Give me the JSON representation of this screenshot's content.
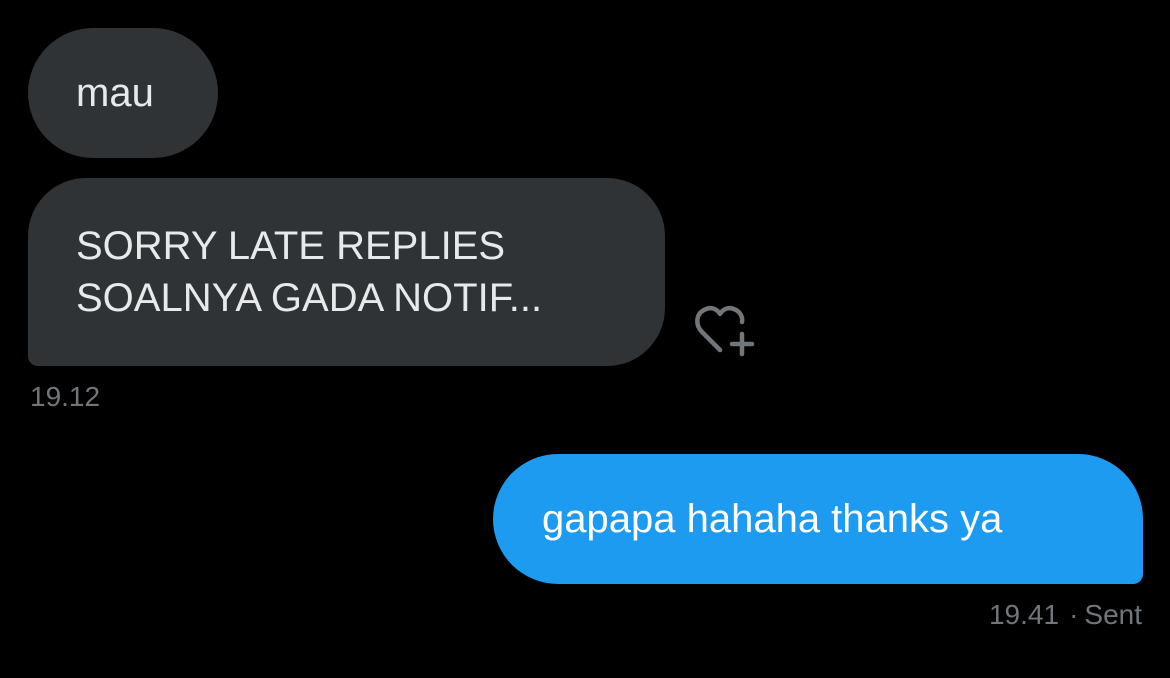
{
  "messages": [
    {
      "direction": "received",
      "lines": [
        "mau"
      ]
    },
    {
      "direction": "received",
      "lines": [
        "SORRY LATE REPLIES",
        "SOALNYA GADA NOTIF..."
      ],
      "time": "19.12"
    },
    {
      "direction": "sent",
      "lines": [
        "gapapa hahaha thanks ya"
      ],
      "time": "19.41",
      "status": "Sent"
    }
  ],
  "separator": "·",
  "icons": {
    "react": "heart-plus-icon"
  },
  "colors": {
    "background": "#000000",
    "received_bubble": "#2f3336",
    "sent_bubble": "#1d9bf0",
    "meta_text": "#71767b",
    "text": "#e7e9ea"
  }
}
